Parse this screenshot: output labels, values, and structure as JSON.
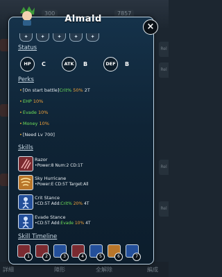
{
  "background": {
    "top_stats": [
      "300",
      "7857"
    ],
    "right_tabs": [
      "Rel",
      "Rel",
      "Rel",
      "Rel"
    ],
    "bottom_labels": [
      "詳細",
      "陣形",
      "全解除",
      "編成"
    ]
  },
  "modal": {
    "title": "Almald",
    "close_label": "×",
    "gems": [
      "✦",
      "✦",
      "✦",
      "✦",
      "✦"
    ],
    "status": {
      "heading": "Status",
      "stats": [
        {
          "label": "HP",
          "grade": "C"
        },
        {
          "label": "ATK",
          "grade": "B"
        },
        {
          "label": "DEF",
          "grade": "B"
        }
      ]
    },
    "perks": {
      "heading": "Perks",
      "items": [
        {
          "pre": "[On start battle]",
          "stat": "Crit%",
          "value": "50%",
          "post": " 2T"
        },
        {
          "pre": "",
          "stat": "EHP",
          "value": "10%",
          "post": ""
        },
        {
          "pre": "",
          "stat": "Evade",
          "value": "10%",
          "post": ""
        },
        {
          "pre": "",
          "stat": "Money",
          "value": "10%",
          "post": ""
        },
        {
          "pre": "[Need Lv 700]",
          "stat": "",
          "value": "",
          "post": ""
        }
      ]
    },
    "skills": {
      "heading": "Skills",
      "items": [
        {
          "name": "Razor",
          "desc": "•Power:8 Num:2 CD:1T",
          "color": "#8a2f35"
        },
        {
          "name": "Sky Hurricane",
          "desc": "•Power:E CD:5T Target:All",
          "color": "#c9852a"
        },
        {
          "name": "Crit Stance",
          "desc_pre": "•CD:5T Add:",
          "desc_stat": "Crit%",
          "desc_value": "20%",
          "desc_post": " 4T",
          "color": "#2b62b8"
        },
        {
          "name": "Evade Stance",
          "desc_pre": "•CD:5T Add:",
          "desc_stat": "Evade",
          "desc_value": "10%",
          "desc_post": " 4T",
          "color": "#2b62b8"
        }
      ]
    },
    "timeline": {
      "heading": "Skill Timeline",
      "slots": [
        "1",
        "2",
        "3",
        "4",
        "5",
        "6",
        "7"
      ]
    }
  }
}
